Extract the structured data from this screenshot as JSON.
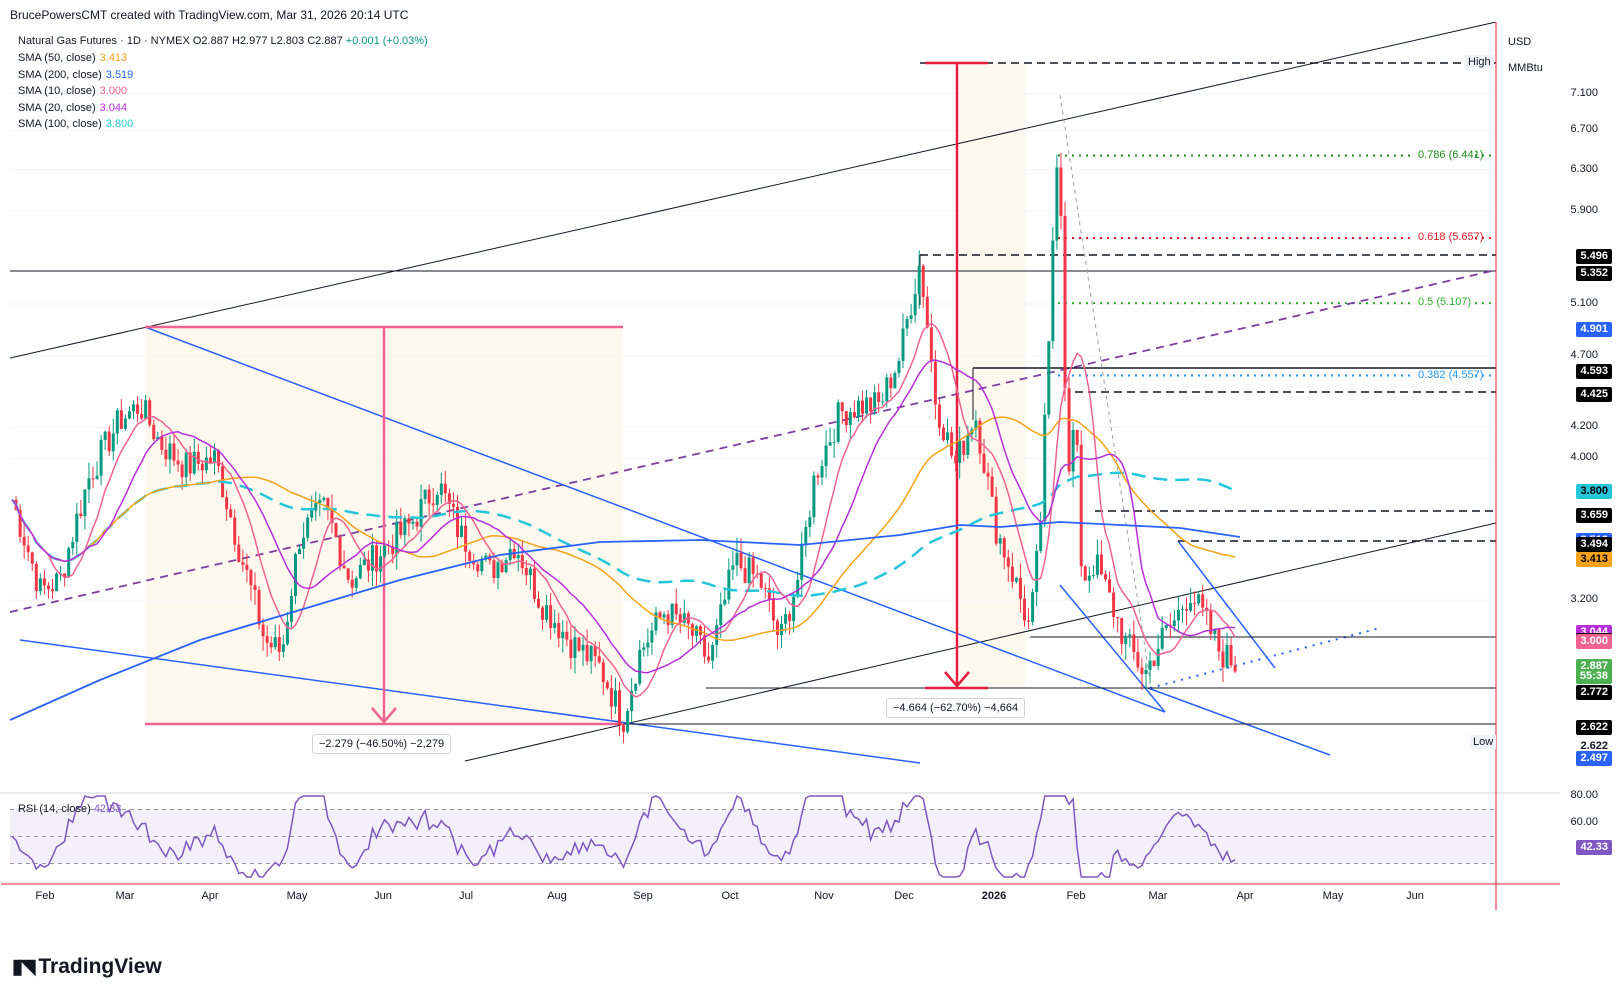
{
  "attribution": "BrucePowersCMT created with TradingView.com, Mar 31, 2026 20:14 UTC",
  "symbol": {
    "name": "Natural Gas Futures",
    "interval": "1D",
    "exchange": "NYMEX",
    "ohlc": "O2.887  H2.977  L2.803  C2.887",
    "change": "+0.001 (+0.03%)"
  },
  "indicators": [
    {
      "label": "SMA (50, close)",
      "value": "3.413",
      "color": "#f7a21b"
    },
    {
      "label": "SMA (200, close)",
      "value": "3.519",
      "color": "#2962ff"
    },
    {
      "label": "SMA (10, close)",
      "value": "3.000",
      "color": "#f06292"
    },
    {
      "label": "SMA (20, close)",
      "value": "3.044",
      "color": "#b72fd9"
    },
    {
      "label": "SMA (100, close)",
      "value": "3.800",
      "color": "#26c6da"
    }
  ],
  "axis": {
    "currency": "USD",
    "unit": "MMBtu",
    "high_label": "High",
    "low_label": "Low",
    "ticks": [
      "7.100",
      "6.700",
      "6.300",
      "5.900",
      "5.100",
      "4.700",
      "4.200",
      "4.000",
      "3.200"
    ],
    "ymin_price": 2.45,
    "ymax_price": 7.45,
    "log_scale": true
  },
  "price_tags": [
    {
      "value": "5.496",
      "bg": "#000000",
      "fg": "#ffffff",
      "price": 5.496
    },
    {
      "value": "5.352",
      "bg": "#000000",
      "fg": "#ffffff",
      "price": 5.352
    },
    {
      "value": "4.901",
      "bg": "#2962ff",
      "fg": "#ffffff",
      "price": 4.901
    },
    {
      "value": "4.593",
      "bg": "#000000",
      "fg": "#ffffff",
      "price": 4.593
    },
    {
      "value": "4.425",
      "bg": "#000000",
      "fg": "#ffffff",
      "price": 4.425
    },
    {
      "value": "3.800",
      "bg": "#26c6da",
      "fg": "#000000",
      "price": 3.8
    },
    {
      "value": "3.659",
      "bg": "#000000",
      "fg": "#ffffff",
      "price": 3.659
    },
    {
      "value": "3.519",
      "bg": "#2962ff",
      "fg": "#ffffff",
      "price": 3.519
    },
    {
      "value": "3.494",
      "bg": "#000000",
      "fg": "#ffffff",
      "price": 3.494
    },
    {
      "value": "3.413",
      "bg": "#f7a21b",
      "fg": "#000000",
      "price": 3.413
    },
    {
      "value": "3.044",
      "bg": "#b72fd9",
      "fg": "#ffffff",
      "price": 3.044
    },
    {
      "value": "3.006",
      "bg": "#000000",
      "fg": "#ffffff",
      "price": 3.006
    },
    {
      "value": "3.000",
      "bg": "#f06292",
      "fg": "#ffffff",
      "price": 3.0
    },
    {
      "value": "2.887",
      "bg": "#4caf50",
      "fg": "#ffffff",
      "price": 2.887
    },
    {
      "value": "55:38",
      "bg": "#4caf50",
      "fg": "#ffffff",
      "price": 2.84
    },
    {
      "value": "2.772",
      "bg": "#000000",
      "fg": "#ffffff",
      "price": 2.772
    },
    {
      "value": "2.622",
      "bg": "#000000",
      "fg": "#ffffff",
      "price": 2.622
    },
    {
      "value": "2.622",
      "bg": "#ffffff",
      "fg": "#131722",
      "price": 2.545
    },
    {
      "value": "2.497",
      "bg": "#2962ff",
      "fg": "#ffffff",
      "price": 2.497
    }
  ],
  "fib_levels": [
    {
      "label": "0.786 (6.441)",
      "price": 6.441,
      "color": "#1b8a1b"
    },
    {
      "label": "0.618 (5.657)",
      "price": 5.657,
      "color": "#e01b24"
    },
    {
      "label": "0.5 (5.107)",
      "price": 5.107,
      "color": "#2fb12f"
    },
    {
      "label": "0.382 (4.557)",
      "price": 4.557,
      "color": "#2196f3"
    }
  ],
  "measures": [
    {
      "label": "−2.279 (−46.50%) −2,279",
      "color": "#f06292"
    },
    {
      "label": "−4.664 (−62.70%) −4,664",
      "color": "#e91e3f"
    }
  ],
  "x_axis": [
    "Feb",
    "Mar",
    "Apr",
    "May",
    "Jun",
    "Jul",
    "Aug",
    "Sep",
    "Oct",
    "Nov",
    "Dec",
    "2026",
    "Feb",
    "Mar",
    "Apr",
    "May",
    "Jun"
  ],
  "rsi": {
    "label": "RSI (14, close)",
    "value": "42.33",
    "color": "#7e57c2",
    "ticks": [
      "80.00",
      "60.00"
    ]
  },
  "chart_data": {
    "type": "line",
    "title": "Natural Gas Futures · 1D · NYMEX",
    "xlabel": "",
    "ylabel": "USD / MMBtu",
    "ylim": [
      2.45,
      7.45
    ],
    "x": [
      "Feb 2025",
      "Mar 2025",
      "Apr 2025",
      "May 2025",
      "Jun 2025",
      "Jul 2025",
      "Aug 2025",
      "Sep 2025",
      "Oct 2025",
      "Nov 2025",
      "Dec 2025",
      "Jan 2026",
      "Feb 2026",
      "Mar 2026",
      "Apr 2026"
    ],
    "series": [
      {
        "name": "Natural Gas Futures",
        "values": [
          3.7,
          4.3,
          3.9,
          3.3,
          3.8,
          3.4,
          2.95,
          2.8,
          3.3,
          4.4,
          4.9,
          3.8,
          3.2,
          3.0,
          2.887
        ]
      },
      {
        "name": "SMA (50, close)",
        "values": [
          3.5,
          3.8,
          4.0,
          3.6,
          3.7,
          3.4,
          3.2,
          3.0,
          3.1,
          3.8,
          4.3,
          4.4,
          3.7,
          3.45,
          3.413
        ]
      },
      {
        "name": "SMA (200, close)",
        "values": [
          2.5,
          2.8,
          3.0,
          3.2,
          3.4,
          3.5,
          3.55,
          3.55,
          3.5,
          3.55,
          3.6,
          3.6,
          3.6,
          3.55,
          3.519
        ]
      },
      {
        "name": "SMA (10, close)",
        "values": [
          3.6,
          4.2,
          3.9,
          3.2,
          3.8,
          3.3,
          3.0,
          2.9,
          3.2,
          4.3,
          4.8,
          3.8,
          3.4,
          3.05,
          3.0
        ]
      },
      {
        "name": "SMA (20, close)",
        "values": [
          3.7,
          4.1,
          3.9,
          3.3,
          3.7,
          3.4,
          3.0,
          2.9,
          3.1,
          4.1,
          4.8,
          3.9,
          3.9,
          3.1,
          3.044
        ]
      },
      {
        "name": "SMA (100, close)",
        "values": [
          3.0,
          3.5,
          3.9,
          3.8,
          3.7,
          3.6,
          3.45,
          3.35,
          3.4,
          3.6,
          3.85,
          3.9,
          3.95,
          3.8,
          3.8
        ]
      }
    ],
    "annotations": {
      "high": 7.45,
      "low": 2.622,
      "horizontal_levels": [
        5.496,
        5.352,
        4.593,
        4.425,
        3.659,
        3.494,
        3.006,
        2.772,
        2.622
      ]
    }
  }
}
